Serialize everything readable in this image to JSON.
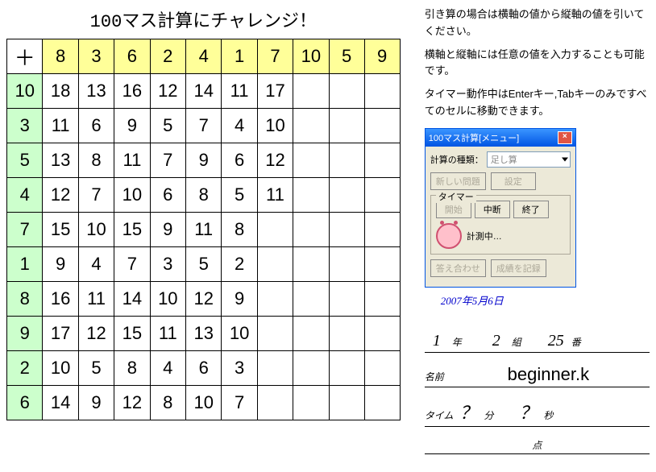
{
  "title": "100マス計算にチャレンジ！",
  "grid": {
    "op": "＋",
    "cols": [
      "8",
      "3",
      "6",
      "2",
      "4",
      "1",
      "7",
      "10",
      "5",
      "9"
    ],
    "rows": [
      "10",
      "3",
      "5",
      "4",
      "7",
      "1",
      "8",
      "9",
      "2",
      "6"
    ],
    "cells": [
      [
        "18",
        "13",
        "16",
        "12",
        "14",
        "11",
        "17",
        "",
        "",
        ""
      ],
      [
        "11",
        "6",
        "9",
        "5",
        "7",
        "4",
        "10",
        "",
        "",
        ""
      ],
      [
        "13",
        "8",
        "11",
        "7",
        "9",
        "6",
        "12",
        "",
        "",
        ""
      ],
      [
        "12",
        "7",
        "10",
        "6",
        "8",
        "5",
        "11",
        "",
        "",
        ""
      ],
      [
        "15",
        "10",
        "15",
        "9",
        "11",
        "8",
        "",
        "",
        "",
        ""
      ],
      [
        "9",
        "4",
        "7",
        "3",
        "5",
        "2",
        "",
        "",
        "",
        ""
      ],
      [
        "16",
        "11",
        "14",
        "10",
        "12",
        "9",
        "",
        "",
        "",
        ""
      ],
      [
        "17",
        "12",
        "15",
        "11",
        "13",
        "10",
        "",
        "",
        "",
        ""
      ],
      [
        "10",
        "5",
        "8",
        "4",
        "6",
        "3",
        "",
        "",
        "",
        ""
      ],
      [
        "14",
        "9",
        "12",
        "8",
        "10",
        "7",
        "",
        "",
        "",
        ""
      ]
    ]
  },
  "instructions": {
    "p1": "引き算の場合は横軸の値から縦軸の値を引いてください。",
    "p2": "横軸と縦軸には任意の値を入力することも可能です。",
    "p3": "タイマー動作中はEnterキー,Tabキーのみですべてのセルに移動できます。"
  },
  "menu": {
    "title": "100マス計算[メニュー]",
    "calc_type_label": "計算の種類：",
    "calc_type_value": "足し算",
    "new_problem": "新しい問題",
    "settings": "設定",
    "timer_label": "タイマー",
    "start": "開始",
    "stop": "中断",
    "end": "終了",
    "measuring": "計測中…",
    "check": "答え合わせ",
    "record": "成績を記録"
  },
  "date": "2007年5月6日",
  "student": {
    "grade": "1",
    "grade_lbl": "年",
    "class": "2",
    "class_lbl": "組",
    "number": "25",
    "number_lbl": "番",
    "name_lbl": "名前",
    "name": "beginner.k",
    "time_lbl": "タイム",
    "min": "？",
    "min_lbl": "分",
    "sec": "？",
    "sec_lbl": "秒",
    "score_lbl": "点"
  },
  "chart_data": {
    "type": "table",
    "title": "100マス計算 (Addition drill grid)",
    "operation": "addition",
    "column_headers": [
      8,
      3,
      6,
      2,
      4,
      1,
      7,
      10,
      5,
      9
    ],
    "row_headers": [
      10,
      3,
      5,
      4,
      7,
      1,
      8,
      9,
      2,
      6
    ],
    "filled_values": [
      [
        18,
        13,
        16,
        12,
        14,
        11,
        17,
        null,
        null,
        null
      ],
      [
        11,
        6,
        9,
        5,
        7,
        4,
        10,
        null,
        null,
        null
      ],
      [
        13,
        8,
        11,
        7,
        9,
        6,
        12,
        null,
        null,
        null
      ],
      [
        12,
        7,
        10,
        6,
        8,
        5,
        11,
        null,
        null,
        null
      ],
      [
        15,
        10,
        15,
        9,
        11,
        8,
        null,
        null,
        null,
        null
      ],
      [
        9,
        4,
        7,
        3,
        5,
        2,
        null,
        null,
        null,
        null
      ],
      [
        16,
        11,
        14,
        10,
        12,
        9,
        null,
        null,
        null,
        null
      ],
      [
        17,
        12,
        15,
        11,
        13,
        10,
        null,
        null,
        null,
        null
      ],
      [
        10,
        5,
        8,
        4,
        6,
        3,
        null,
        null,
        null,
        null
      ],
      [
        14,
        9,
        12,
        8,
        10,
        7,
        null,
        null,
        null,
        null
      ]
    ]
  }
}
